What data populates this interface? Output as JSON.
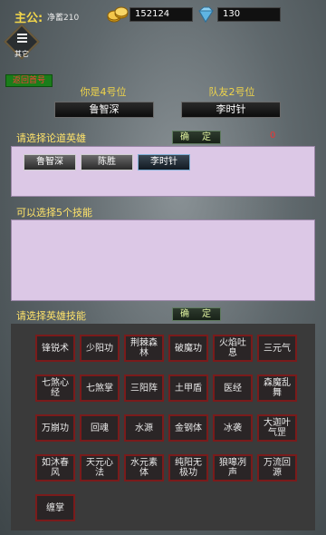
{
  "header": {
    "lord_label": "主公:",
    "lord_name": "净蓄210",
    "gold": "152124",
    "gems": "130",
    "gold_icon": "coin-stack-icon",
    "gem_icon": "gem-icon"
  },
  "other_button": {
    "label": "其它",
    "icon": "menu-icon"
  },
  "return_button": {
    "label": "返回首号"
  },
  "positions": {
    "you": {
      "label": "你是4号位",
      "hero": "鲁智深"
    },
    "teammate": {
      "label": "队友2号位",
      "hero": "李时针"
    }
  },
  "choose_hero": {
    "title": "请选择论道英雄",
    "confirm": "确　定",
    "count": "0",
    "heroes": [
      "鲁智深",
      "陈胜",
      "李时针"
    ]
  },
  "choose_five": {
    "title": "可以选择5个技能"
  },
  "choose_skills": {
    "title": "请选择英雄技能",
    "confirm": "确　定",
    "skills": [
      "锋锐术",
      "少阳功",
      "荆棘森林",
      "破魔功",
      "火焰吐息",
      "三元气",
      "七煞心经",
      "七煞掌",
      "三阳阵",
      "土甲盾",
      "医经",
      "森魔乱舞",
      "万崩功",
      "回魂",
      "水源",
      "金钢体",
      "冰袭",
      "大迦叶气罡",
      "如沐春风",
      "天元心法",
      "水元素体",
      "纯阳无极功",
      "狼嗥冽声",
      "万流回源",
      "缠掌"
    ]
  },
  "colors": {
    "accent": "#f0d54a",
    "panel": "#dcc8e6",
    "skill_border": "#7a1b1b"
  }
}
